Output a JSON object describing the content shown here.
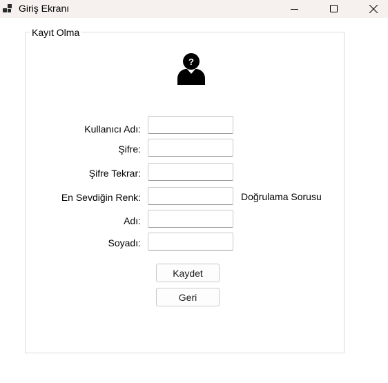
{
  "window": {
    "title": "Giriş Ekranı"
  },
  "group": {
    "title": "Kayıt Olma"
  },
  "form": {
    "fields": [
      {
        "label": "Kullanıcı Adı:",
        "value": ""
      },
      {
        "label": "Şifre:",
        "value": ""
      },
      {
        "label": "Şifre Tekrar:",
        "value": ""
      },
      {
        "label": "En Sevdiğin Renk:",
        "value": ""
      },
      {
        "label": "Adı:",
        "value": ""
      },
      {
        "label": "Soyadı:",
        "value": ""
      }
    ],
    "verification_hint": "Doğrulama Sorusu"
  },
  "buttons": {
    "save_label": "Kaydet",
    "back_label": "Geri"
  },
  "icons": {
    "app": "app-window-icon",
    "user": "unknown-user-icon",
    "minimize": "minimize-icon",
    "maximize": "maximize-icon",
    "close": "close-icon"
  },
  "colors": {
    "titlebar_bg": "#f6f1ee",
    "group_border": "#dcdcdc"
  }
}
